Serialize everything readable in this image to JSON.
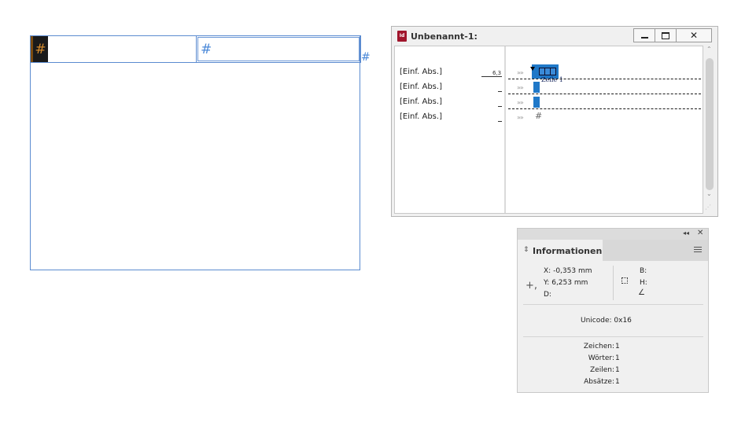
{
  "layout": {
    "selected_char": "#",
    "cell2_char": "#",
    "overflow_char": "#"
  },
  "story_editor": {
    "title": "Unbenannt-1:",
    "app_icon_label": "Id",
    "paragraph_styles": [
      "[Einf. Abs.]",
      "[Einf. Abs.]",
      "[Einf. Abs.]",
      "[Einf. Abs.]"
    ],
    "depth_value": "6,3",
    "row_label": "Zeile 1",
    "chevron": "»»",
    "last_line_char": "#",
    "scroll_up": "⌃",
    "scroll_down": "⌄"
  },
  "info_panel": {
    "tab_label": "Informationen",
    "x_label": "X:",
    "x_value": "-0,353 mm",
    "y_label": "Y:",
    "y_value": "6,253 mm",
    "d_label": "D:",
    "b_label": "B:",
    "h_label": "H:",
    "unicode_label": "Unicode:",
    "unicode_value": "0x16",
    "stats": [
      {
        "label": "Zeichen:",
        "value": "1"
      },
      {
        "label": "Wörter:",
        "value": "1"
      },
      {
        "label": "Zeilen:",
        "value": "1"
      },
      {
        "label": "Absätze:",
        "value": "1"
      }
    ]
  },
  "colors": {
    "frame_blue": "#5b8bd0",
    "selection_dark": "#1a1a1a",
    "hidden_char_orange": "#d48a2c",
    "story_highlight_blue": "#1f78c8",
    "app_icon_red": "#a0152c"
  },
  "icons": {
    "window_minimize": "minimize-icon",
    "window_maximize": "maximize-icon",
    "window_close": "close-icon",
    "panel_collapse": "double-chevron-icon",
    "panel_close": "close-icon",
    "panel_menu": "hamburger-menu-icon",
    "position": "crosshair-icon",
    "size": "bounding-box-icon",
    "angle": "angle-icon",
    "table": "table-icon"
  }
}
